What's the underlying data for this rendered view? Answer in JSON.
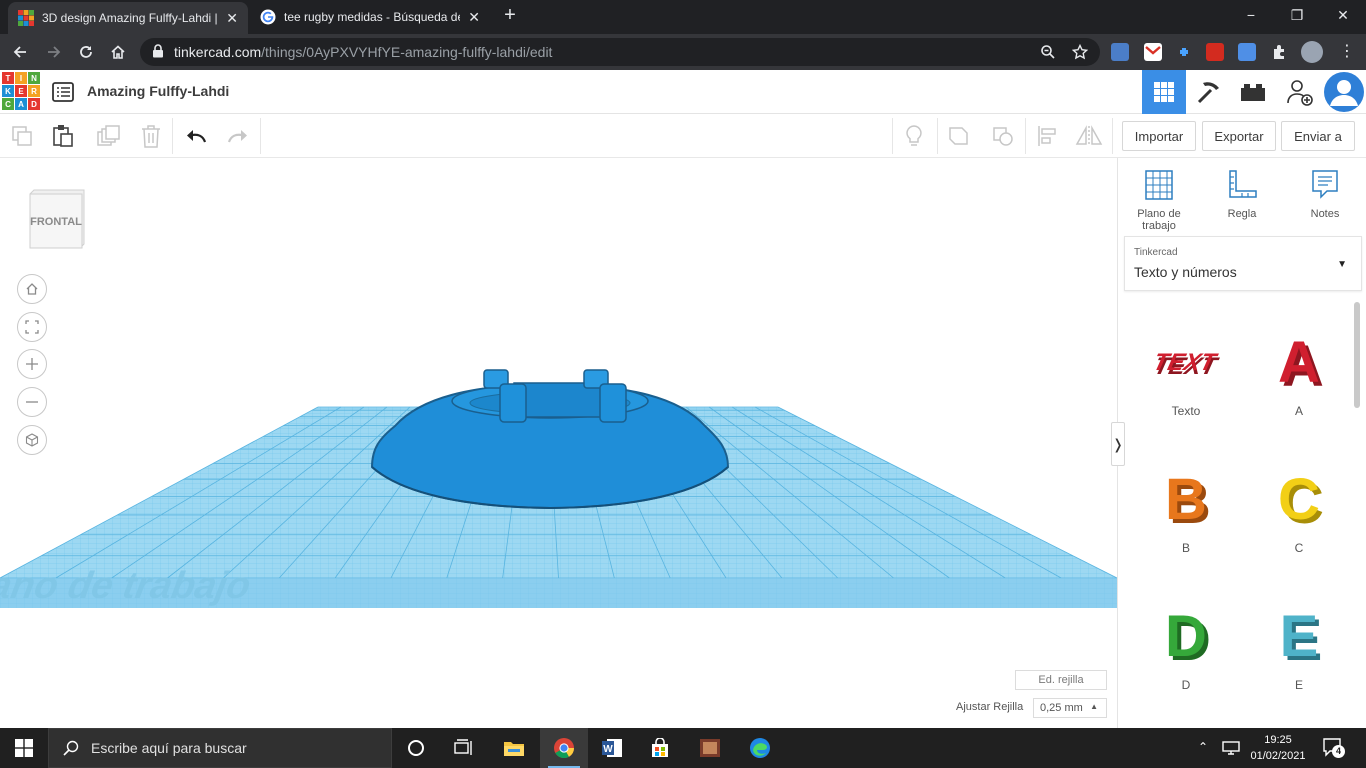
{
  "browser": {
    "tabs": [
      {
        "title": "3D design Amazing Fulffy-Lahdi | T",
        "active": true
      },
      {
        "title": "tee rugby medidas - Búsqueda de",
        "active": false
      }
    ],
    "new_tab": "+",
    "window_controls": {
      "minimize": "−",
      "maximize": "❐",
      "close": "✕"
    },
    "url_host": "tinkercad.com",
    "url_path": "/things/0AyPXVYHfYE-amazing-fulffy-lahdi/edit"
  },
  "header": {
    "logo": {
      "row1": [
        "T",
        "I",
        "N"
      ],
      "row2": [
        "K",
        "E",
        "R"
      ],
      "row3": [
        "C",
        "A",
        "D"
      ]
    },
    "design_title": "Amazing Fulffy-Lahdi"
  },
  "edit_toolbar": {
    "import_label": "Importar",
    "export_label": "Exportar",
    "send_label": "Enviar a"
  },
  "viewport": {
    "viewcube_label": "FRONTAL",
    "workplane_label": "Plano de trabajo",
    "grid_edit_label": "Ed. rejilla",
    "snap_label": "Ajustar Rejilla",
    "snap_value": "0,25 mm"
  },
  "panel": {
    "tools": [
      {
        "label": "Plano de trabajo",
        "icon": "workplane-icon"
      },
      {
        "label": "Regla",
        "icon": "ruler-icon"
      },
      {
        "label": "Notes",
        "icon": "notes-icon"
      }
    ],
    "library_caption": "Tinkercad",
    "library_value": "Texto y números",
    "shapes": [
      {
        "label": "Texto",
        "glyph": "TEXT",
        "color": "#d01f2f"
      },
      {
        "label": "A",
        "glyph": "A",
        "color": "#d01f2f"
      },
      {
        "label": "B",
        "glyph": "B",
        "color": "#e8771c"
      },
      {
        "label": "C",
        "glyph": "C",
        "color": "#f2cf16"
      },
      {
        "label": "D",
        "glyph": "D",
        "color": "#35a83a"
      },
      {
        "label": "E",
        "glyph": "E",
        "color": "#4fb3c9"
      }
    ]
  },
  "taskbar": {
    "search_placeholder": "Escribe aquí para buscar",
    "time": "19:25",
    "date": "01/02/2021",
    "notification_count": "4"
  },
  "colors": {
    "tinkercad_accent": "#3a8ee6",
    "shape_blue": "#1f8ed8",
    "workplane": "#8ed2f0"
  }
}
